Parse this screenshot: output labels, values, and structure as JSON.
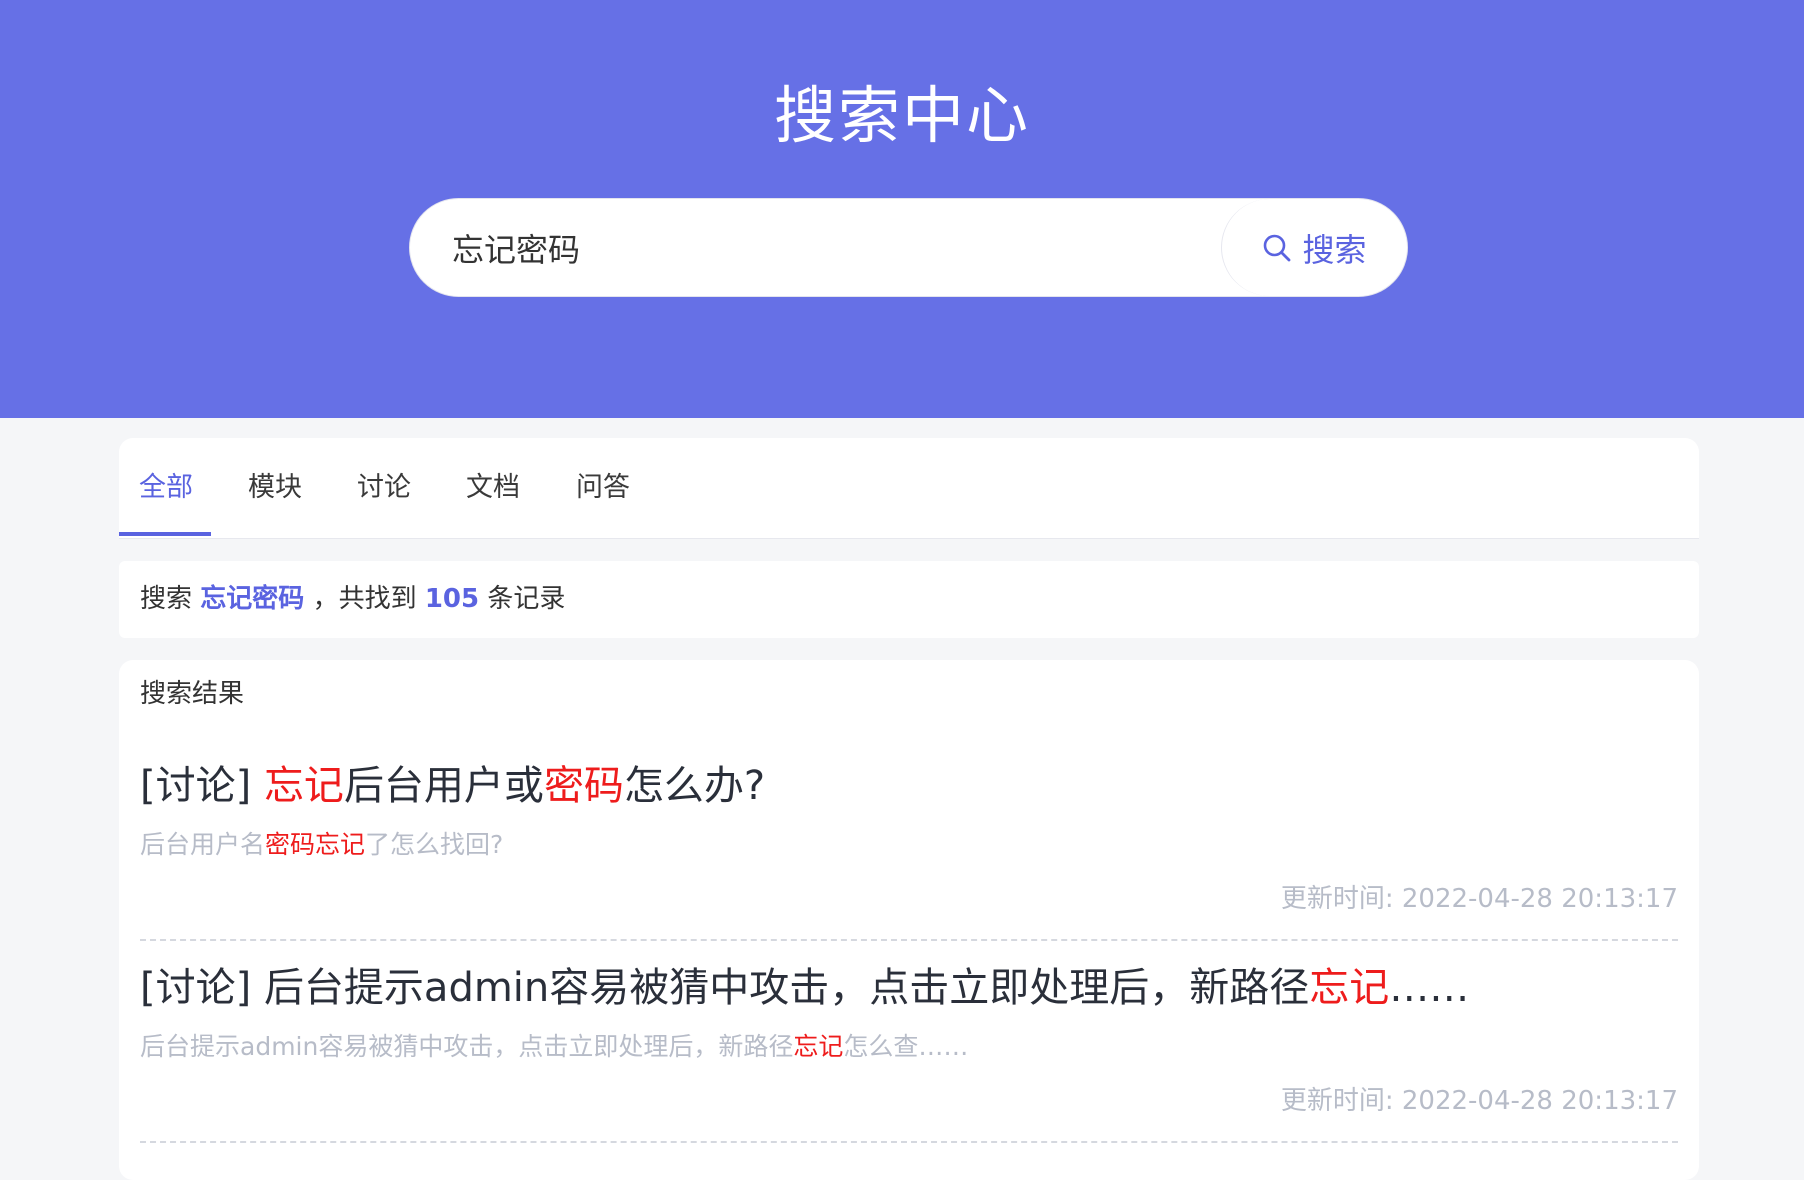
{
  "header": {
    "title": "搜索中心"
  },
  "search": {
    "value": "忘记密码",
    "button_label": "搜索"
  },
  "tabs": [
    {
      "label": "全部",
      "active": true
    },
    {
      "label": "模块"
    },
    {
      "label": "讨论"
    },
    {
      "label": "文档"
    },
    {
      "label": "问答"
    }
  ],
  "summary": {
    "prefix": "搜索",
    "keyword": "忘记密码",
    "middle": "，共找到",
    "count": "105",
    "suffix": "条记录"
  },
  "results_heading": "搜索结果",
  "results": [
    {
      "category": "[讨论]",
      "title_parts": [
        "忘记",
        "后台用户或",
        "密码",
        "怎么办?"
      ],
      "snippet_parts": [
        "后台用户名",
        "密码忘记",
        "了怎么找回?"
      ],
      "updated_label": "更新时间:",
      "updated": "2022-04-28 20:13:17"
    },
    {
      "category": "[讨论]",
      "title_parts": [
        "后台提示admin容易被猜中攻击，点击立即处理后，新路径",
        "忘记",
        "……"
      ],
      "snippet_parts": [
        "后台提示admin容易被猜中攻击，点击立即处理后，新路径",
        "忘记",
        "怎么查……"
      ],
      "updated_label": "更新时间:",
      "updated": "2022-04-28 20:13:17"
    }
  ],
  "colors": {
    "brand": "#6670e6",
    "accent": "#5a63e0",
    "highlight": "#ee1c1c",
    "muted": "#b7bcc8"
  }
}
